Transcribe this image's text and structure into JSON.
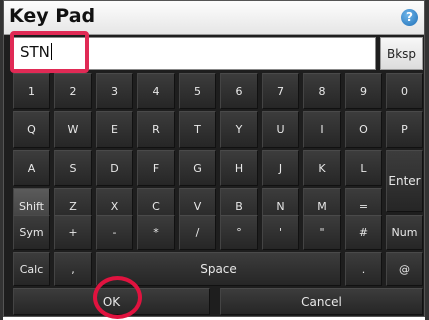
{
  "window": {
    "title": "Key Pad"
  },
  "input": {
    "value": "STN"
  },
  "keys": {
    "backspace": "Bksp",
    "row1": [
      "1",
      "2",
      "3",
      "4",
      "5",
      "6",
      "7",
      "8",
      "9",
      "0"
    ],
    "row2": [
      "Q",
      "W",
      "E",
      "R",
      "T",
      "Y",
      "U",
      "I",
      "O",
      "P"
    ],
    "row3": [
      "A",
      "S",
      "D",
      "F",
      "G",
      "H",
      "J",
      "K",
      "L"
    ],
    "enter": "Enter",
    "shift": "Shift",
    "row4": [
      "Z",
      "X",
      "C",
      "V",
      "B",
      "N",
      "M",
      "="
    ],
    "sym": "Sym",
    "row5": [
      "+",
      "-",
      "*",
      "/",
      "°",
      "'",
      "\"",
      "#"
    ],
    "num": "Num",
    "calc": "Calc",
    "comma": ",",
    "space": "Space",
    "period": ".",
    "at": "@",
    "ok": "OK",
    "cancel": "Cancel"
  },
  "colors": {
    "highlight": "#e02a55",
    "help_icon": "#1f6fb7"
  },
  "icons": {
    "help": "help-icon"
  }
}
